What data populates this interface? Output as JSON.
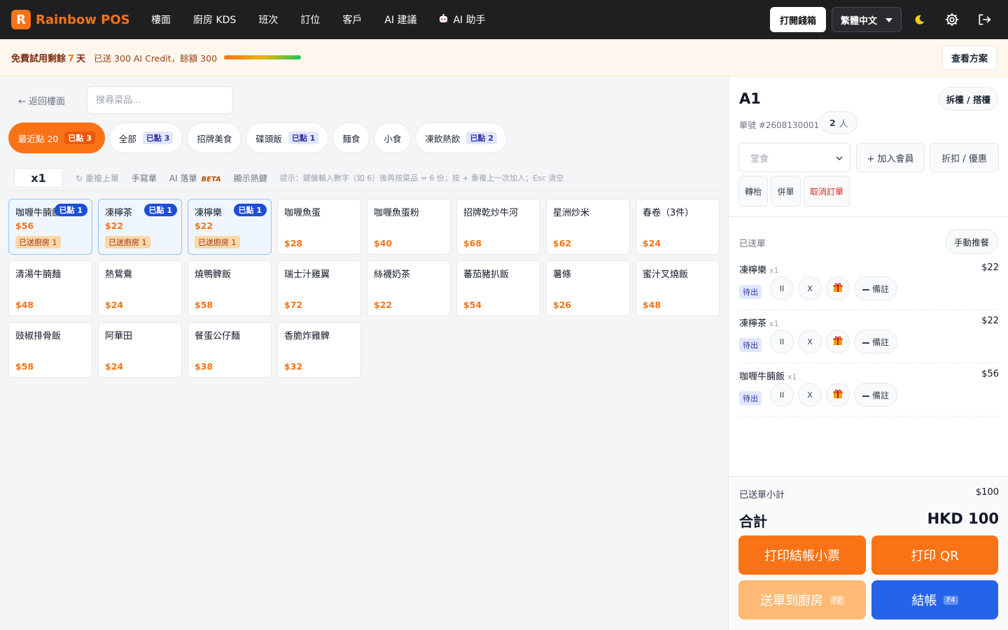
{
  "app": {
    "logo_letter": "R",
    "name": "Rainbow POS",
    "brand_color": "#f97316"
  },
  "nav": [
    {
      "label": "樓面"
    },
    {
      "label": "廚房 KDS"
    },
    {
      "label": "班次"
    },
    {
      "label": "訂位"
    },
    {
      "label": "客戶"
    },
    {
      "label": "AI 建議"
    },
    {
      "label": "AI 助手",
      "icon": "robot-icon"
    }
  ],
  "topbar": {
    "open_drawer": "打開錢箱",
    "language": "繁體中文",
    "icons": [
      "moon-icon",
      "gear-icon",
      "logout-icon"
    ]
  },
  "trial": {
    "prefix": "免費試用剩餘",
    "days": "7",
    "suffix": "天",
    "credit_text": "已送 300 AI Credit，餘額 300",
    "credit_fraction": 1.0,
    "plan_button": "查看方案"
  },
  "menu": {
    "back": "← 返回樓面",
    "search_placeholder": "搜尋菜品...",
    "categories": [
      {
        "label": "最近點 20",
        "badge": "已點 3",
        "active": true
      },
      {
        "label": "全部",
        "badge": "已點 3"
      },
      {
        "label": "招牌美食",
        "badge": ""
      },
      {
        "label": "碟頭飯",
        "badge": "已點 1"
      },
      {
        "label": "麵食",
        "badge": ""
      },
      {
        "label": "小食",
        "badge": ""
      },
      {
        "label": "凍飲熱飲",
        "badge": "已點 2"
      }
    ],
    "toolbar": {
      "qty": "x1",
      "repeat": "↻ 重複上單",
      "handwrite": "手寫單",
      "ai_order": "AI 落單",
      "beta": "BETA",
      "hotkeys": "顯示熱鍵",
      "hint": "提示：鍵盤輸入數字（如 6）後再按菜品 = 6 份；按 + 重複上一次加入；Esc 清空"
    },
    "items": [
      {
        "name": "咖喱牛腩飯",
        "price": "$56",
        "ordered": "已點 1",
        "sent": "已送廚房 1"
      },
      {
        "name": "凍檸茶",
        "price": "$22",
        "ordered": "已點 1",
        "sent": "已送廚房 1"
      },
      {
        "name": "凍檸樂",
        "price": "$22",
        "ordered": "已點 1",
        "sent": "已送廚房 1"
      },
      {
        "name": "咖喱魚蛋",
        "price": "$28"
      },
      {
        "name": "咖喱魚蛋粉",
        "price": "$40"
      },
      {
        "name": "招牌乾炒牛河",
        "price": "$68"
      },
      {
        "name": "星洲炒米",
        "price": "$62"
      },
      {
        "name": "春卷（3件）",
        "price": "$24"
      },
      {
        "name": "清湯牛腩麵",
        "price": "$48"
      },
      {
        "name": "熱鴛鴦",
        "price": "$24"
      },
      {
        "name": "燒鴨髀飯",
        "price": "$58"
      },
      {
        "name": "瑞士汁雞翼",
        "price": "$72"
      },
      {
        "name": "絲襪奶茶",
        "price": "$22"
      },
      {
        "name": "蕃茄豬扒飯",
        "price": "$54"
      },
      {
        "name": "薯條",
        "price": "$26"
      },
      {
        "name": "蜜汁叉燒飯",
        "price": "$48"
      },
      {
        "name": "豉椒排骨飯",
        "price": "$58"
      },
      {
        "name": "阿華田",
        "price": "$24"
      },
      {
        "name": "餐蛋公仔麵",
        "price": "$38"
      },
      {
        "name": "香脆炸雞髀",
        "price": "$32"
      }
    ]
  },
  "order": {
    "table": "A1",
    "split_button": "拆檯 / 搭檯",
    "order_no": "單號 #2608130001",
    "pax_count": "2",
    "pax_unit": "人",
    "dine_mode": "堂食",
    "add_member": "+ 加入會員",
    "discount": "折扣 / 優惠",
    "transfer": "轉枱",
    "merge": "併單",
    "cancel": "取消訂單",
    "sent_label": "已送單",
    "rush_button": "手動推餐",
    "lines": [
      {
        "name": "凍檸樂",
        "qty": "x1",
        "price": "$22",
        "status": "待出",
        "pause": "II",
        "void": "X",
        "note": "備註"
      },
      {
        "name": "凍檸茶",
        "qty": "x1",
        "price": "$22",
        "status": "待出",
        "pause": "II",
        "void": "X",
        "note": "備註"
      },
      {
        "name": "咖喱牛腩飯",
        "qty": "x1",
        "price": "$56",
        "status": "待出",
        "pause": "II",
        "void": "X",
        "note": "備註"
      }
    ],
    "subtotal_label": "已送單小計",
    "subtotal_value": "$100",
    "total_label": "合計",
    "total_value": "HKD 100",
    "print_receipt": "打印結帳小票",
    "print_qr": "打印 QR",
    "send_kitchen": "送單到廚房",
    "send_key": "F2",
    "checkout": "結帳",
    "checkout_key": "F4"
  }
}
